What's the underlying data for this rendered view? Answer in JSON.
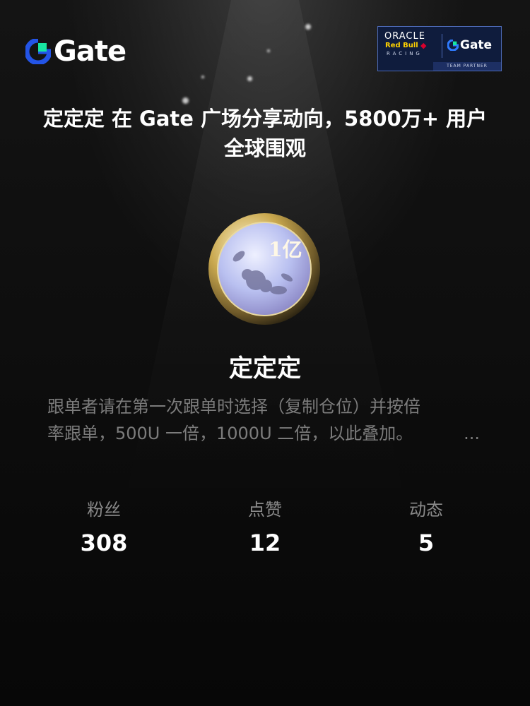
{
  "brand": {
    "logo_text": "Gate"
  },
  "partner_badge": {
    "oracle": "ORACLE",
    "redbull": "Red Bull",
    "racing": "RACING",
    "gate": "Gate",
    "team": "TEAM PARTNER"
  },
  "headline": "定定定 在 Gate 广场分享动向，5800万+ 用户全球围观",
  "profile": {
    "coin_text": "1亿",
    "username": "定定定",
    "bio_line1": "跟单者请在第一次跟单时选择（复制仓位）并按倍",
    "bio_line2": "率跟单，500U 一倍，1000U 二倍，以此叠加。",
    "bio_ellipsis": "..."
  },
  "stats": [
    {
      "label": "粉丝",
      "value": "308"
    },
    {
      "label": "点赞",
      "value": "12"
    },
    {
      "label": "动态",
      "value": "5"
    }
  ],
  "colors": {
    "brand_blue": "#2354e6",
    "brand_green": "#17e6a1",
    "background": "#0c0c0c"
  }
}
